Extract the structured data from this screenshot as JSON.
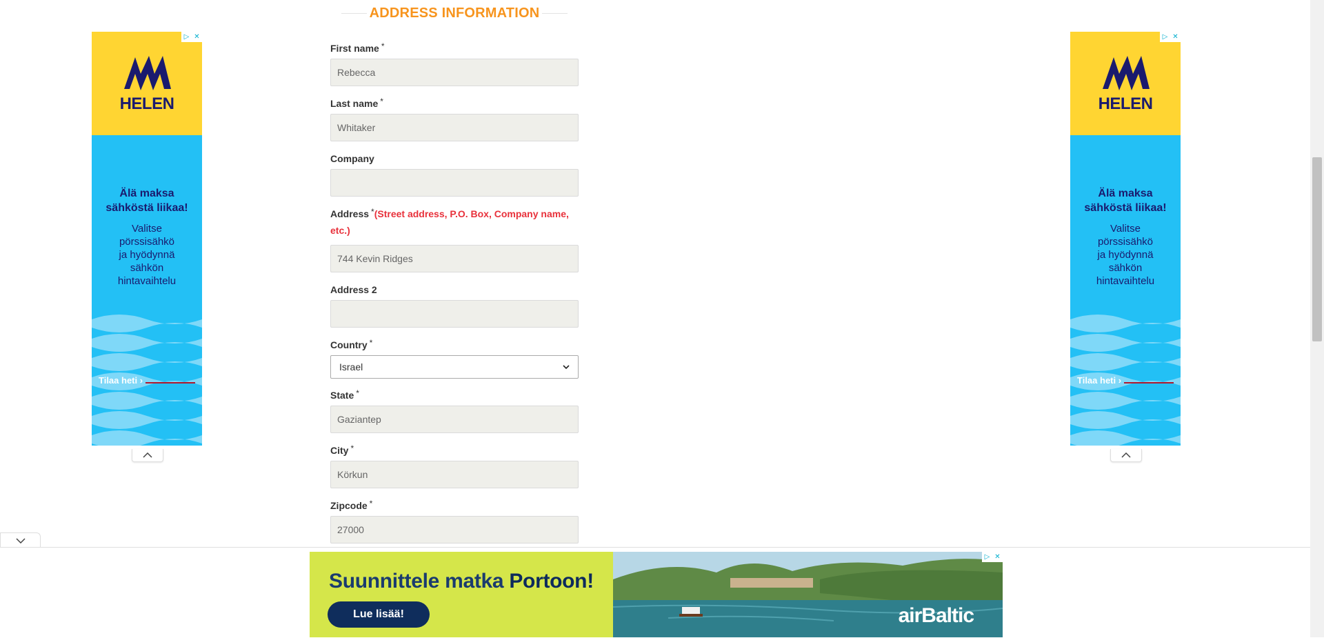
{
  "form": {
    "section_title": "ADDRESS INFORMATION",
    "required_marker": "*",
    "fields": {
      "first_name": {
        "label": "First name",
        "value": "Rebecca"
      },
      "last_name": {
        "label": "Last name",
        "value": "Whitaker"
      },
      "company": {
        "label": "Company",
        "value": ""
      },
      "address": {
        "label": "Address",
        "hint": "(Street address, P.O. Box, Company name, etc.)",
        "value": "744 Kevin Ridges"
      },
      "address2": {
        "label": "Address 2",
        "value": ""
      },
      "country": {
        "label": "Country",
        "selected": "Israel"
      },
      "state": {
        "label": "State",
        "value": "Gaziantep"
      },
      "city": {
        "label": "City",
        "value": "Körkun"
      },
      "zipcode": {
        "label": "Zipcode",
        "value": "27000"
      }
    }
  },
  "side_ad": {
    "brand": "HELEN",
    "headline_1": "Älä maksa",
    "headline_2": "sähköstä liikaa!",
    "copy_1": "Valitse pörssisähkö",
    "copy_2": "ja hyödynnä",
    "copy_3": "sähkön",
    "copy_4": "hintavaihtelu",
    "cta": "Tilaa heti ›",
    "colors": {
      "top": "#ffd532",
      "body": "#23c0f5",
      "text": "#1a1a6e"
    }
  },
  "bottom_ad": {
    "headline_prefix": "Suunnittele matka ",
    "headline_bold": "Portoon!",
    "button": "Lue lisää!",
    "logo": "airBaltic",
    "colors": {
      "background": "#d5e64a",
      "button": "#0f2d5c"
    }
  },
  "colors": {
    "section_title": "#f7941d",
    "hint": "#e8313b"
  }
}
